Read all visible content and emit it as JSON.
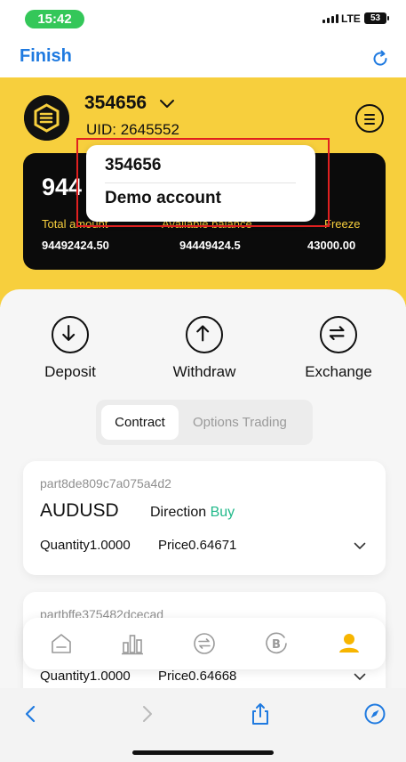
{
  "status_bar": {
    "time": "15:42",
    "network": "LTE",
    "battery": "53"
  },
  "browser": {
    "done_label": "Finish"
  },
  "account": {
    "name": "354656",
    "uid": "UID: 2645552"
  },
  "balance": {
    "big_value": "944",
    "total_label": "Total amount",
    "available_label": "Available balance",
    "freeze_label": "Freeze",
    "total_value": "94492424.50",
    "available_value": "94449424.5",
    "freeze_value": "43000.00"
  },
  "account_menu": {
    "options": [
      "354656",
      "Demo account"
    ]
  },
  "actions": [
    {
      "label": "Deposit",
      "icon": "arrow-down-icon"
    },
    {
      "label": "Withdraw",
      "icon": "arrow-up-icon"
    },
    {
      "label": "Exchange",
      "icon": "exchange-icon"
    }
  ],
  "segments": {
    "active": "Contract",
    "inactive": "Options Trading"
  },
  "positions": [
    {
      "id": "part8de809c7a075a4d2",
      "symbol": "AUDUSD",
      "direction_label": "Direction",
      "direction_value": "Buy",
      "quantity": "Quantity1.0000",
      "price": "Price0.64671"
    },
    {
      "id": "partbffe375482dcecad",
      "quantity": "Quantity1.0000",
      "price": "Price0.64668"
    }
  ],
  "colors": {
    "accent_yellow": "#f7cf3d",
    "buy_green": "#21b98a",
    "link_blue": "#1f7ae0",
    "status_green": "#34c759"
  }
}
